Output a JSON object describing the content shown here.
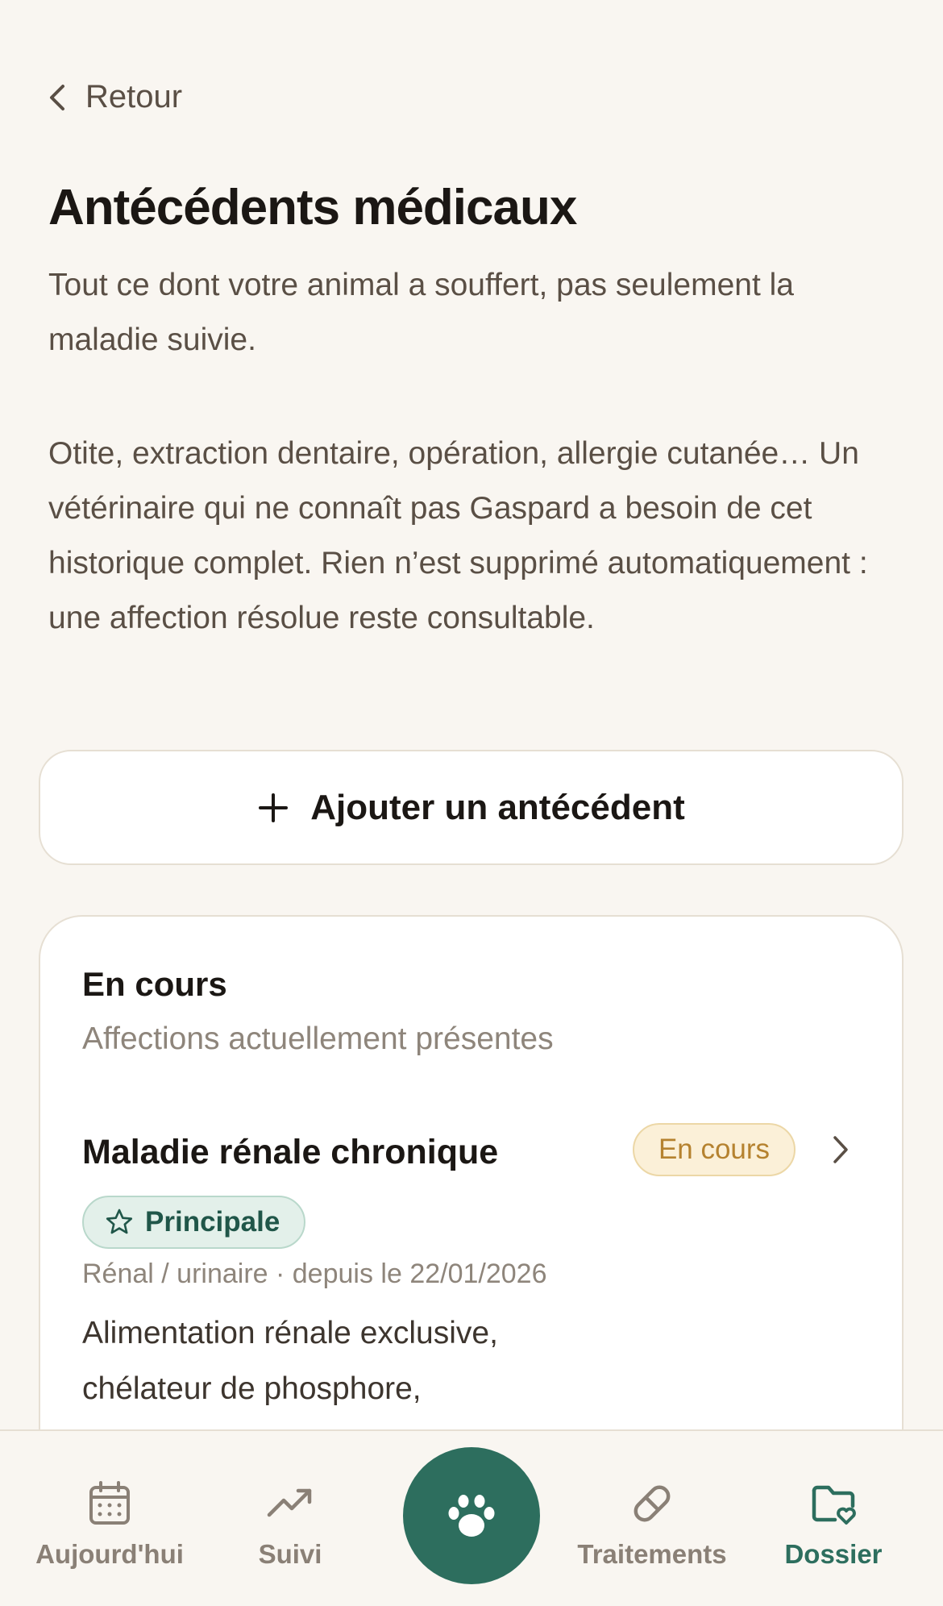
{
  "nav": {
    "back_label": "Retour"
  },
  "page": {
    "title": "Antécédents médicaux",
    "intro_1": "Tout ce dont votre animal a souffert, pas seulement la maladie suivie.",
    "intro_2": "Otite, extraction dentaire, opération, allergie cutanée… Un vétérinaire qui ne connaît pas Gaspard a besoin de cet historique complet. Rien n’est supprimé automatiquement : une affection résolue reste consultable."
  },
  "actions": {
    "add_label": "Ajouter un antécédent"
  },
  "section": {
    "title": "En cours",
    "subtitle": "Affections actuellement présentes",
    "items": [
      {
        "title": "Maladie rénale chronique",
        "status": "En cours",
        "tag": "Principale",
        "meta": "Rénal / urinaire · depuis le 22/01/2026",
        "description": "Alimentation rénale exclusive, chélateur de phosphore,"
      }
    ]
  },
  "tabbar": {
    "items": [
      {
        "label": "Aujourd'hui",
        "icon": "calendar-icon"
      },
      {
        "label": "Suivi",
        "icon": "trend-icon"
      },
      {
        "label": "",
        "icon": "paw-icon"
      },
      {
        "label": "Traitements",
        "icon": "pill-icon"
      },
      {
        "label": "Dossier",
        "icon": "folder-heart-icon"
      }
    ],
    "active": "Dossier"
  },
  "colors": {
    "background": "#f9f6f1",
    "accent": "#2d6e5e",
    "status_ongoing": "#b5822f",
    "muted_text": "#8e857b"
  }
}
